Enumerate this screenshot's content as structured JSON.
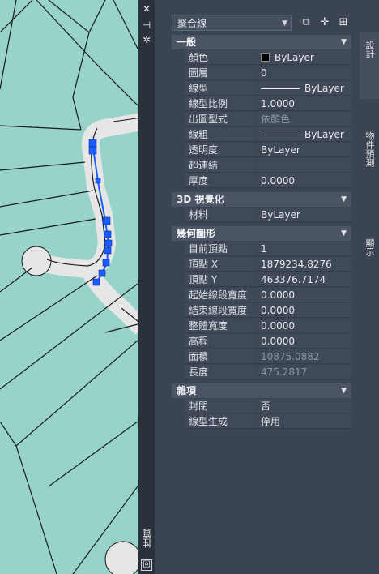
{
  "palette": {
    "title": "性質",
    "object_selector": "聚合線",
    "sections": [
      {
        "title": "一般",
        "rows": [
          {
            "name": "顏色",
            "value": "ByLayer",
            "swatch": "#000000"
          },
          {
            "name": "圖層",
            "value": "0"
          },
          {
            "name": "線型",
            "value": "ByLayer",
            "linetype": true
          },
          {
            "name": "線型比例",
            "value": "1.0000"
          },
          {
            "name": "出圖型式",
            "value": "依顏色",
            "dim": true
          },
          {
            "name": "線粗",
            "value": "ByLayer",
            "linetype": true
          },
          {
            "name": "透明度",
            "value": "ByLayer"
          },
          {
            "name": "超連結",
            "value": ""
          },
          {
            "name": "厚度",
            "value": "0.0000"
          }
        ]
      },
      {
        "title": "3D 視覺化",
        "rows": [
          {
            "name": "材料",
            "value": "ByLayer"
          }
        ]
      },
      {
        "title": "幾何圖形",
        "rows": [
          {
            "name": "目前頂點",
            "value": "1"
          },
          {
            "name": "頂點 X",
            "value": "1879234.8276"
          },
          {
            "name": "頂點 Y",
            "value": "463376.7174"
          },
          {
            "name": "起始線段寬度",
            "value": "0.0000"
          },
          {
            "name": "結束線段寬度",
            "value": "0.0000"
          },
          {
            "name": "整體寬度",
            "value": "0.0000"
          },
          {
            "name": "高程",
            "value": "0.0000"
          },
          {
            "name": "面積",
            "value": "10875.0882",
            "dim": true
          },
          {
            "name": "長度",
            "value": "475.2817",
            "dim": true
          }
        ]
      },
      {
        "title": "雜項",
        "rows": [
          {
            "name": "封閉",
            "value": "否"
          },
          {
            "name": "線型生成",
            "value": "停用"
          }
        ]
      }
    ],
    "tabs": [
      "設計",
      "物件預測",
      "顯示"
    ]
  },
  "colors": {
    "map_fill": "#97d3c9",
    "road": "#e6e6e6",
    "selection": "#1a5cff",
    "panel_bg": "#3b4453"
  },
  "icons": [
    "close-icon",
    "autohide-icon",
    "settings-icon",
    "quick-select-icon",
    "select-objects-icon",
    "toggle-pickadd-icon",
    "chevron-down-icon"
  ]
}
